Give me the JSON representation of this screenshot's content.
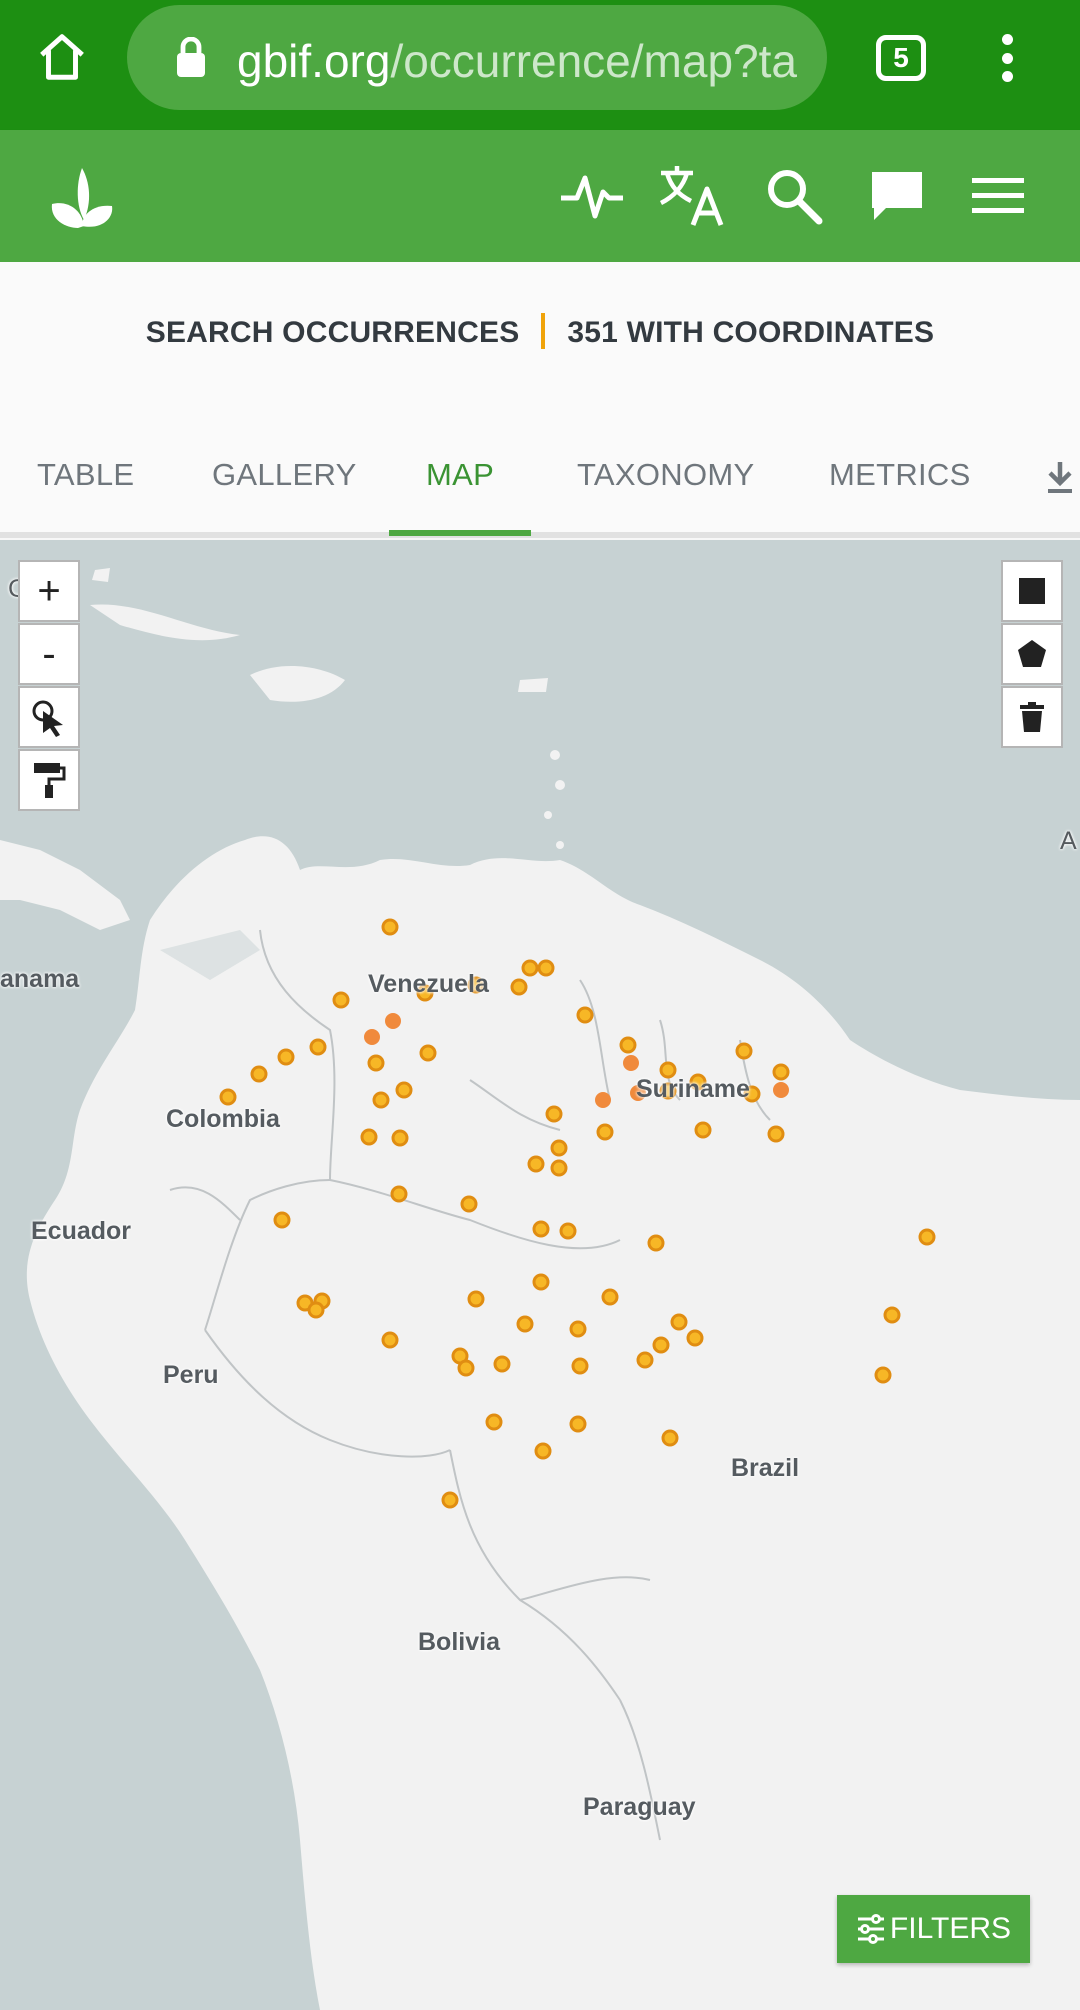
{
  "browser": {
    "url_domain": "gbif.org",
    "url_path": "/occurrence/map?ta",
    "tab_count": "5",
    "icons": [
      "home-icon",
      "lock-icon",
      "tabs-icon",
      "kebab-menu-icon"
    ]
  },
  "header": {
    "icons": [
      "gbif-logo-icon",
      "activity-pulse-icon",
      "translate-icon",
      "search-icon",
      "chat-icon",
      "hamburger-menu-icon"
    ]
  },
  "summary": {
    "left": "SEARCH OCCURRENCES",
    "right": "351 WITH COORDINATES"
  },
  "tabs": [
    {
      "label": "TABLE",
      "active": false
    },
    {
      "label": "GALLERY",
      "active": false
    },
    {
      "label": "MAP",
      "active": true
    },
    {
      "label": "TAXONOMY",
      "active": false
    },
    {
      "label": "METRICS",
      "active": false
    }
  ],
  "map": {
    "labels": {
      "venezuela": "Venezuela",
      "colombia": "Colombia",
      "ecuador": "Ecuador",
      "peru": "Peru",
      "brazil": "Brazil",
      "bolivia": "Bolivia",
      "paraguay": "Paraguay",
      "suriname": "Suriname",
      "panama": "anama",
      "edge_left": "C",
      "edge_right": "A"
    },
    "controls_left": {
      "zoom_in": "+",
      "zoom_out": "-"
    },
    "filters_label": "FILTERS",
    "colors": {
      "water": "#c7d2d3",
      "land": "#f2f2f2",
      "dot": "#f7b726",
      "dot_dense": "#f08a3c"
    }
  }
}
